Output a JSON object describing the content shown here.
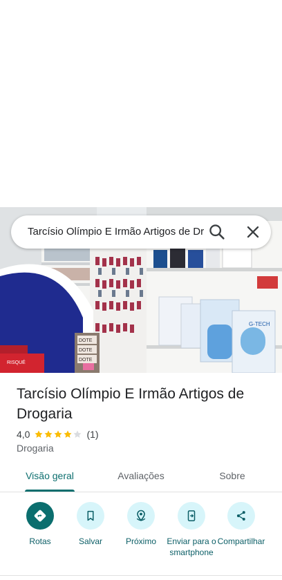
{
  "search": {
    "query": "Tarcísio Olímpio E Irmão Artigos de Dr",
    "search_icon": "search-icon",
    "close_icon": "close-icon"
  },
  "place": {
    "name": "Tarcísio Olímpio E Irmão Artigos de Drogaria",
    "rating": "4,0",
    "stars_filled": 4,
    "stars_total": 5,
    "review_count": "(1)",
    "category": "Drogaria"
  },
  "photo": {
    "signs": [
      "DOTE",
      "DOTE",
      "DOTE",
      "RISQUÉ",
      "G-TECH"
    ]
  },
  "tabs": [
    {
      "label": "Visão geral",
      "active": true
    },
    {
      "label": "Avaliações",
      "active": false
    },
    {
      "label": "Sobre",
      "active": false
    }
  ],
  "actions": [
    {
      "label": "Rotas",
      "icon": "directions-icon",
      "primary": true
    },
    {
      "label": "Salvar",
      "icon": "bookmark-icon",
      "primary": false
    },
    {
      "label": "Próximo",
      "icon": "nearby-icon",
      "primary": false
    },
    {
      "label": "Enviar para o smartphone",
      "icon": "send-to-phone-icon",
      "primary": false
    },
    {
      "label": "Compartilhar",
      "icon": "share-icon",
      "primary": false
    }
  ],
  "colors": {
    "accent": "#0b6e6e",
    "action_bg": "#d7f5fa",
    "star": "#fbbc04",
    "star_empty": "#dadce0"
  }
}
